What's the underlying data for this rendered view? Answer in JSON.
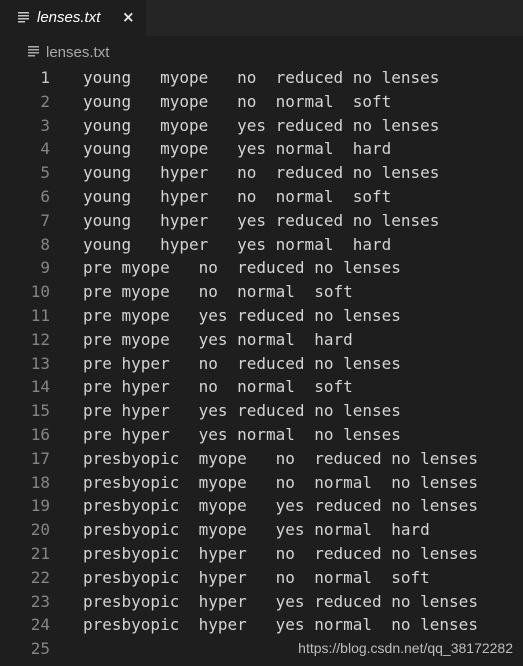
{
  "tab": {
    "file_icon": "lines-icon",
    "title": "lenses.txt",
    "close": "×"
  },
  "breadcrumb": {
    "file_icon": "lines-icon",
    "label": "lenses.txt"
  },
  "editor": {
    "active_line": 1,
    "lines": [
      {
        "n": "1",
        "text": "young\tmyope\tno\treduced\tno lenses"
      },
      {
        "n": "2",
        "text": "young\tmyope\tno\tnormal\tsoft"
      },
      {
        "n": "3",
        "text": "young\tmyope\tyes\treduced\tno lenses"
      },
      {
        "n": "4",
        "text": "young\tmyope\tyes\tnormal\thard"
      },
      {
        "n": "5",
        "text": "young\thyper\tno\treduced\tno lenses"
      },
      {
        "n": "6",
        "text": "young\thyper\tno\tnormal\tsoft"
      },
      {
        "n": "7",
        "text": "young\thyper\tyes\treduced\tno lenses"
      },
      {
        "n": "8",
        "text": "young\thyper\tyes\tnormal\thard"
      },
      {
        "n": "9",
        "text": "pre\tmyope\tno\treduced\tno lenses"
      },
      {
        "n": "10",
        "text": "pre\tmyope\tno\tnormal\tsoft"
      },
      {
        "n": "11",
        "text": "pre\tmyope\tyes\treduced\tno lenses"
      },
      {
        "n": "12",
        "text": "pre\tmyope\tyes\tnormal\thard"
      },
      {
        "n": "13",
        "text": "pre\thyper\tno\treduced\tno lenses"
      },
      {
        "n": "14",
        "text": "pre\thyper\tno\tnormal\tsoft"
      },
      {
        "n": "15",
        "text": "pre\thyper\tyes\treduced\tno lenses"
      },
      {
        "n": "16",
        "text": "pre\thyper\tyes\tnormal\tno lenses"
      },
      {
        "n": "17",
        "text": "presbyopic\tmyope\tno\treduced\tno lenses"
      },
      {
        "n": "18",
        "text": "presbyopic\tmyope\tno\tnormal\tno lenses"
      },
      {
        "n": "19",
        "text": "presbyopic\tmyope\tyes\treduced\tno lenses"
      },
      {
        "n": "20",
        "text": "presbyopic\tmyope\tyes\tnormal\thard"
      },
      {
        "n": "21",
        "text": "presbyopic\thyper\tno\treduced\tno lenses"
      },
      {
        "n": "22",
        "text": "presbyopic\thyper\tno\tnormal\tsoft"
      },
      {
        "n": "23",
        "text": "presbyopic\thyper\tyes\treduced\tno lenses"
      },
      {
        "n": "24",
        "text": "presbyopic\thyper\tyes\tnormal\tno lenses"
      },
      {
        "n": "25",
        "text": ""
      }
    ]
  },
  "watermark": "https://blog.csdn.net/qq_38172282",
  "colors": {
    "editor_bg": "#1e1e1e",
    "tabbar_bg": "#252526",
    "text": "#d4d4d4",
    "line_number": "#858585"
  }
}
